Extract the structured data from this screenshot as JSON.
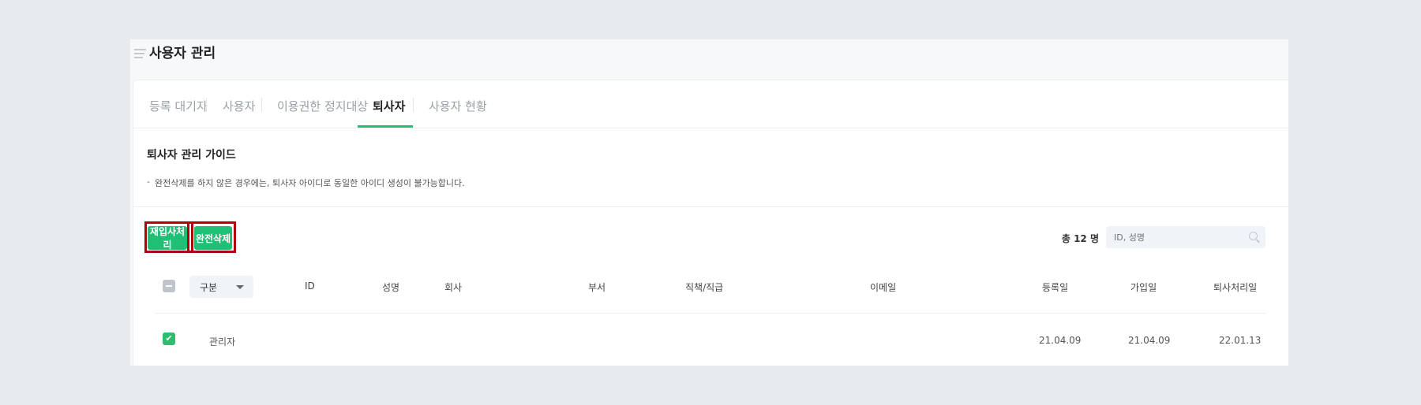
{
  "header": {
    "title": "사용자 관리"
  },
  "tabs": [
    {
      "label": "등록 대기자"
    },
    {
      "label": "사용자"
    },
    {
      "label": "이용권한 정지대상"
    },
    {
      "label": "퇴사자"
    },
    {
      "label": "사용자 현황"
    }
  ],
  "guide": {
    "title": "퇴사자 관리 가이드",
    "bullet": "-",
    "text": "완전삭제를 하지 않은 경우에는, 퇴사자 아이디로 동일한 아이디 생성이 불가능합니다."
  },
  "toolbar": {
    "rehire_label": "재입사처리",
    "delete_label": "완전삭제",
    "total": "총 12 명",
    "search_placeholder": "ID, 성명"
  },
  "table": {
    "type_filter": "구분",
    "columns": [
      "ID",
      "성명",
      "회사",
      "부서",
      "직책/직급",
      "이메일",
      "등록일",
      "가입일",
      "퇴사처리일"
    ],
    "rows": [
      {
        "checked": true,
        "type": "관리자",
        "id": "",
        "name": "",
        "company": "",
        "dept": "",
        "position": "",
        "email": "",
        "registered": "21.04.09",
        "joined": "21.04.09",
        "resigned": "22.01.13"
      }
    ]
  },
  "colors": {
    "accent": "#1fbf75",
    "highlight": "#b0000f"
  }
}
